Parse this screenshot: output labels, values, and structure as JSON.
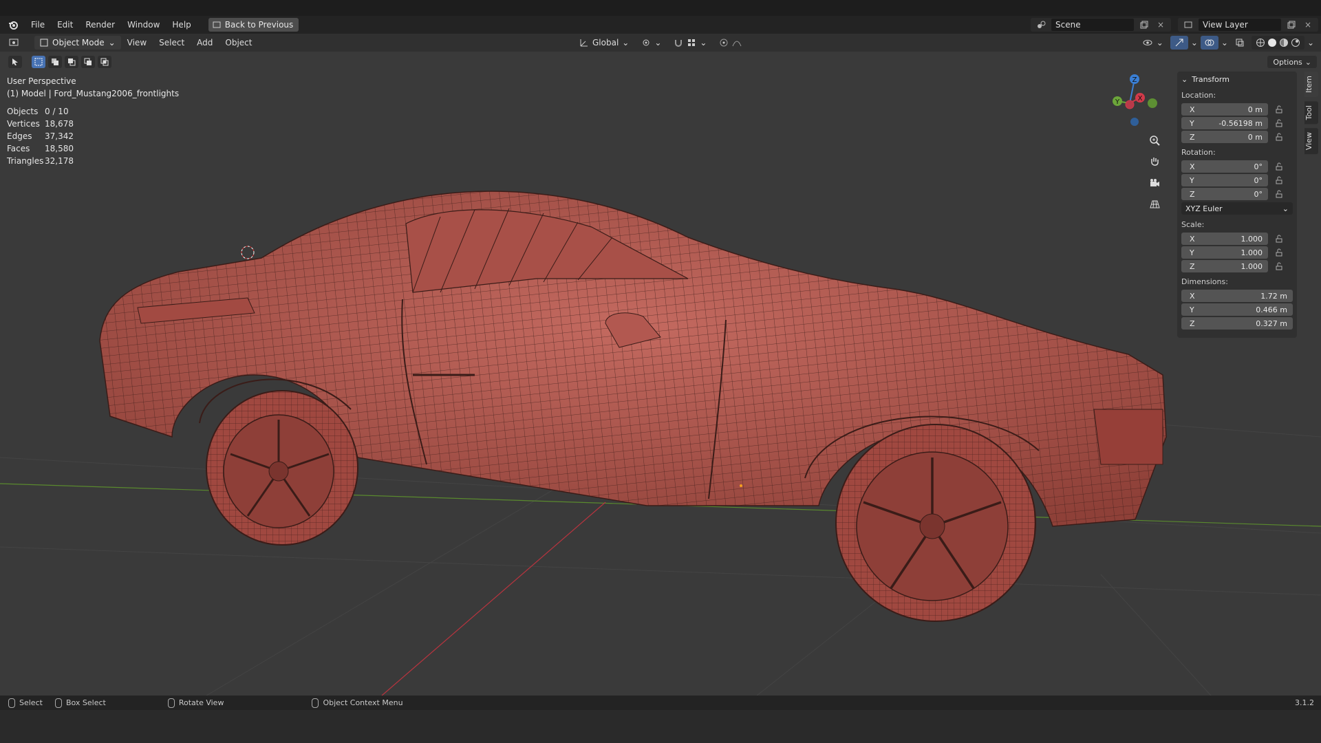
{
  "topbar": {
    "menus": [
      "File",
      "Edit",
      "Render",
      "Window",
      "Help"
    ],
    "back_button": "Back to Previous",
    "scene_name": "Scene",
    "view_layer": "View Layer"
  },
  "header": {
    "mode": "Object Mode",
    "menus": [
      "View",
      "Select",
      "Add",
      "Object"
    ],
    "transform_orientation": "Global",
    "options": "Options"
  },
  "viewport": {
    "perspective": "User Perspective",
    "object_label": "(1) Model | Ford_Mustang2006_frontlights",
    "stats": [
      {
        "label": "Objects",
        "value": "0 / 10"
      },
      {
        "label": "Vertices",
        "value": "18,678"
      },
      {
        "label": "Edges",
        "value": "37,342"
      },
      {
        "label": "Faces",
        "value": "18,580"
      },
      {
        "label": "Triangles",
        "value": "32,178"
      }
    ],
    "gizmo": {
      "x": "X",
      "y": "Y",
      "z": "Z"
    }
  },
  "npanel": {
    "section": "Transform",
    "location_label": "Location:",
    "location": [
      {
        "axis": "X",
        "value": "0 m"
      },
      {
        "axis": "Y",
        "value": "-0.56198 m"
      },
      {
        "axis": "Z",
        "value": "0 m"
      }
    ],
    "rotation_label": "Rotation:",
    "rotation": [
      {
        "axis": "X",
        "value": "0°"
      },
      {
        "axis": "Y",
        "value": "0°"
      },
      {
        "axis": "Z",
        "value": "0°"
      }
    ],
    "rotation_mode": "XYZ Euler",
    "scale_label": "Scale:",
    "scale": [
      {
        "axis": "X",
        "value": "1.000"
      },
      {
        "axis": "Y",
        "value": "1.000"
      },
      {
        "axis": "Z",
        "value": "1.000"
      }
    ],
    "dimensions_label": "Dimensions:",
    "dimensions": [
      {
        "axis": "X",
        "value": "1.72 m"
      },
      {
        "axis": "Y",
        "value": "0.466 m"
      },
      {
        "axis": "Z",
        "value": "0.327 m"
      }
    ],
    "tabs": [
      "Item",
      "Tool",
      "View"
    ]
  },
  "statusbar": {
    "select": "Select",
    "box_select": "Box Select",
    "rotate_view": "Rotate View",
    "context_menu": "Object Context Menu",
    "version": "3.1.2"
  },
  "colors": {
    "mesh": "#b45a52",
    "wire": "#3a1c18",
    "x_axis": "#d23a4a",
    "y_axis": "#6ca63a",
    "z_axis": "#3a7fd5"
  }
}
